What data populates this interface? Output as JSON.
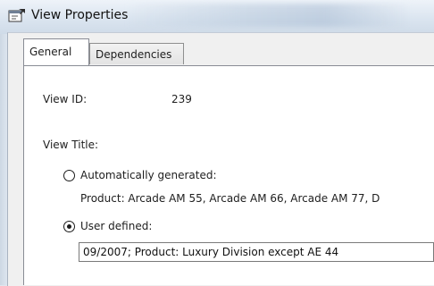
{
  "window": {
    "title": "View Properties"
  },
  "tabs": [
    {
      "label": "General",
      "selected": true
    },
    {
      "label": "Dependencies",
      "selected": false
    }
  ],
  "general": {
    "view_id_label": "View ID:",
    "view_id_value": "239",
    "view_title_label": "View Title:",
    "options": [
      {
        "label": "Automatically generated:",
        "selected": false,
        "value": "Product: Arcade AM 55, Arcade AM 66, Arcade AM 77, D"
      },
      {
        "label": "User defined:",
        "selected": true,
        "value": "09/2007; Product: Luxury Division except AE 44"
      }
    ]
  },
  "icons": {
    "app": "properties-window-icon"
  },
  "colors": {
    "titlebar": "#dbe5f0",
    "panel": "#ffffff",
    "dialog": "#f0f0f0"
  }
}
